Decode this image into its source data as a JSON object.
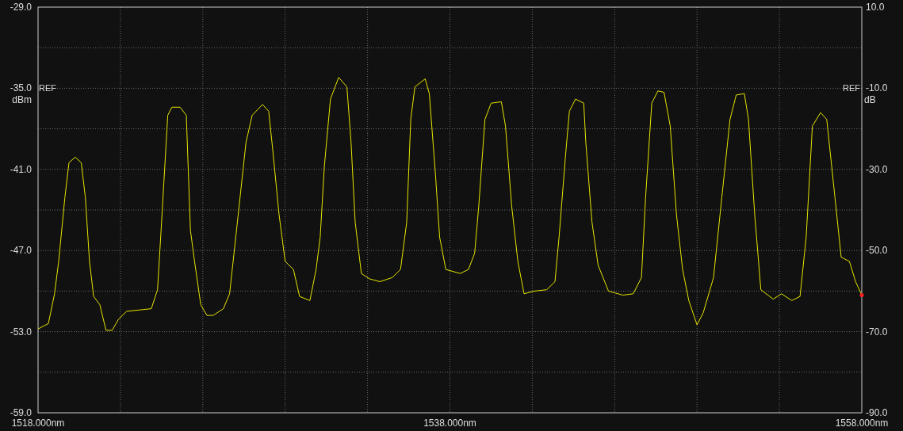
{
  "chart": {
    "chart_data": {
      "type": "line",
      "grid": true,
      "xlim": [
        1518,
        1558
      ],
      "ylim": [
        -59,
        -29
      ],
      "ylabel": "dBm",
      "xticks": [
        {
          "value": 1518,
          "label": "1518.000nm"
        },
        {
          "value": 1538,
          "label": "1538.000nm"
        },
        {
          "value": 1558,
          "label": "1558.000nm"
        }
      ],
      "yticks": [
        {
          "value": -29,
          "label": "-29.0"
        },
        {
          "value": -35,
          "label": "-35.0"
        },
        {
          "value": -41,
          "label": "-41.0"
        },
        {
          "value": -47,
          "label": "-47.0"
        },
        {
          "value": -53,
          "label": "-53.0"
        },
        {
          "value": -59,
          "label": "-59.0"
        }
      ],
      "x": [
        1518.0,
        1518.5,
        1518.8,
        1519.0,
        1519.3,
        1519.5,
        1519.8,
        1520.1,
        1520.3,
        1520.5,
        1520.7,
        1521.0,
        1521.3,
        1521.6,
        1521.9,
        1522.3,
        1522.9,
        1523.5,
        1523.8,
        1524.0,
        1524.3,
        1524.5,
        1524.9,
        1525.2,
        1525.4,
        1525.6,
        1525.9,
        1526.2,
        1526.5,
        1527.0,
        1527.3,
        1527.6,
        1528.1,
        1528.4,
        1528.9,
        1529.2,
        1529.4,
        1529.7,
        1530.0,
        1530.4,
        1530.7,
        1531.2,
        1531.5,
        1531.7,
        1531.9,
        1532.2,
        1532.6,
        1533.0,
        1533.2,
        1533.4,
        1533.7,
        1534.1,
        1534.6,
        1535.2,
        1535.6,
        1535.9,
        1536.1,
        1536.3,
        1536.8,
        1537.0,
        1537.3,
        1537.5,
        1537.8,
        1538.5,
        1538.9,
        1539.2,
        1539.4,
        1539.7,
        1540.0,
        1540.5,
        1540.7,
        1541.0,
        1541.3,
        1541.6,
        1542.1,
        1542.7,
        1543.1,
        1543.3,
        1543.6,
        1543.8,
        1544.1,
        1544.5,
        1544.6,
        1544.9,
        1545.2,
        1545.7,
        1546.4,
        1546.9,
        1547.3,
        1547.5,
        1547.8,
        1548.1,
        1548.4,
        1548.7,
        1549.0,
        1549.3,
        1549.6,
        1550.0,
        1550.3,
        1550.8,
        1551.2,
        1551.6,
        1551.9,
        1552.3,
        1552.5,
        1552.8,
        1553.1,
        1553.7,
        1554.1,
        1554.6,
        1555.0,
        1555.3,
        1555.6,
        1556.0,
        1556.3,
        1556.7,
        1557.0,
        1557.4,
        1557.7,
        1558.0
      ],
      "series": [
        {
          "color": "#e6e600",
          "values": [
            -52.8,
            -52.4,
            -50.2,
            -47.8,
            -43.1,
            -40.5,
            -40.1,
            -40.5,
            -43.1,
            -47.8,
            -50.4,
            -51.0,
            -52.9,
            -52.9,
            -52.1,
            -51.5,
            -51.4,
            -51.3,
            -49.9,
            -44.9,
            -37.0,
            -36.4,
            -36.4,
            -37.0,
            -45.5,
            -47.8,
            -51.0,
            -51.8,
            -51.8,
            -51.3,
            -50.2,
            -46.0,
            -39.0,
            -37.0,
            -36.2,
            -36.7,
            -39.6,
            -44.3,
            -47.8,
            -48.4,
            -50.4,
            -50.7,
            -48.4,
            -46.0,
            -40.8,
            -35.8,
            -34.2,
            -34.9,
            -39.0,
            -44.9,
            -48.7,
            -49.1,
            -49.3,
            -49.0,
            -48.4,
            -44.9,
            -37.3,
            -34.9,
            -34.3,
            -35.4,
            -41.4,
            -46.0,
            -48.4,
            -48.7,
            -48.4,
            -47.2,
            -43.7,
            -37.3,
            -36.1,
            -36.0,
            -37.8,
            -43.7,
            -47.8,
            -50.2,
            -50.0,
            -49.9,
            -49.3,
            -46.0,
            -40.2,
            -36.7,
            -35.8,
            -36.1,
            -39.0,
            -44.9,
            -48.1,
            -50.0,
            -50.3,
            -50.2,
            -49.0,
            -43.1,
            -36.1,
            -35.2,
            -35.3,
            -37.8,
            -44.3,
            -48.4,
            -50.7,
            -52.5,
            -51.6,
            -49.0,
            -43.1,
            -37.3,
            -35.5,
            -35.4,
            -37.3,
            -44.3,
            -49.9,
            -50.6,
            -50.2,
            -50.7,
            -50.4,
            -46.0,
            -37.8,
            -36.8,
            -37.3,
            -43.1,
            -47.5,
            -47.8,
            -49.3,
            -50.3
          ]
        }
      ]
    },
    "ref_left": "REF",
    "ref_right": "REF",
    "right_axis": {
      "unit": "dB",
      "ticks": [
        "10.0",
        "-10.0",
        "-30.0",
        "-50.0",
        "-70.0",
        "-90.0"
      ]
    }
  }
}
